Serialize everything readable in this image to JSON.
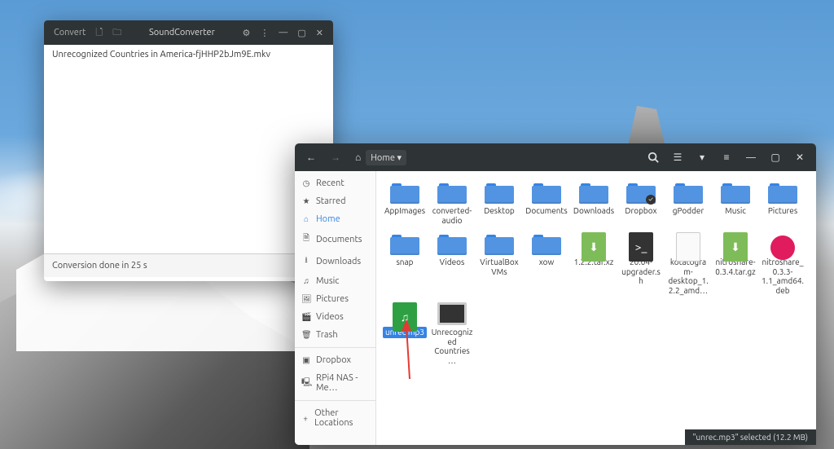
{
  "soundconverter": {
    "convert_label": "Convert",
    "title": "SoundConverter",
    "file_entry": "Unrecognized Countries in America-fjHHP2bJm9E.mkv",
    "status": "Conversion done in 25 s"
  },
  "files": {
    "path_label": "Home",
    "sidebar": [
      {
        "icon": "◷",
        "label": "Recent"
      },
      {
        "icon": "★",
        "label": "Starred"
      },
      {
        "icon": "⌂",
        "label": "Home",
        "active": true
      },
      {
        "icon": "🗎",
        "label": "Documents"
      },
      {
        "icon": "⭳",
        "label": "Downloads"
      },
      {
        "icon": "♫",
        "label": "Music"
      },
      {
        "icon": "🖼",
        "label": "Pictures"
      },
      {
        "icon": "🎬",
        "label": "Videos"
      },
      {
        "icon": "🗑",
        "label": "Trash"
      }
    ],
    "mounts": [
      {
        "icon": "▣",
        "label": "Dropbox"
      },
      {
        "icon": "🖳",
        "label": "RPi4 NAS - Me…"
      }
    ],
    "other_loc": "Other Locations",
    "items": [
      {
        "type": "folder",
        "label": "AppImages"
      },
      {
        "type": "folder",
        "label": "converted-audio"
      },
      {
        "type": "folder",
        "label": "Desktop"
      },
      {
        "type": "folder",
        "label": "Documents"
      },
      {
        "type": "folder",
        "label": "Downloads"
      },
      {
        "type": "folder",
        "label": "Dropbox",
        "badge": "✓"
      },
      {
        "type": "folder",
        "label": "gPodder"
      },
      {
        "type": "folder",
        "label": "Music"
      },
      {
        "type": "folder",
        "label": "Pictures"
      },
      {
        "type": "folder",
        "label": "snap"
      },
      {
        "type": "folder",
        "label": "Videos"
      },
      {
        "type": "folder",
        "label": "VirtualBox VMs"
      },
      {
        "type": "folder",
        "label": "xow"
      },
      {
        "type": "file",
        "fclass": "green-arch",
        "glyph": "⬇",
        "label": "1.2.2.tar.xz"
      },
      {
        "type": "file",
        "fclass": "dark",
        "glyph": ">_",
        "label": "20.04-upgrader.sh"
      },
      {
        "type": "file",
        "fclass": "white",
        "glyph": "",
        "label": "kotatogram-desktop_1.2.2_amd…"
      },
      {
        "type": "file",
        "fclass": "green-arch",
        "glyph": "⬇",
        "label": "nitroshare-0.3.4.tar.gz"
      },
      {
        "type": "file",
        "fclass": "red-deb",
        "glyph": "",
        "label": "nitroshare_0.3.3-1.1_amd64.deb"
      },
      {
        "type": "file",
        "fclass": "green-audio",
        "glyph": "♫",
        "label": "unrec.mp3",
        "selected": true
      },
      {
        "type": "video",
        "label": "Unrecognized Countries …"
      }
    ],
    "status": "\"unrec.mp3\" selected  (12.2 MB)"
  }
}
